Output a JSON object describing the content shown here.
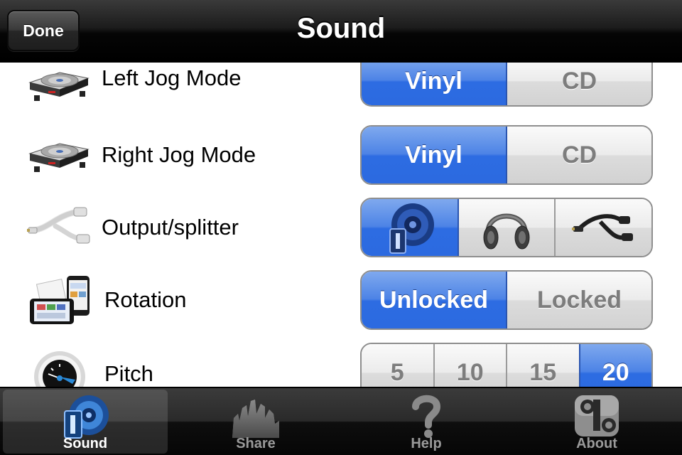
{
  "navbar": {
    "done_label": "Done",
    "title": "Sound"
  },
  "rows": [
    {
      "label": "Left Jog Mode",
      "icon": "turntable-icon",
      "options": [
        "Vinyl",
        "CD"
      ],
      "selected": "Vinyl"
    },
    {
      "label": "Right Jog Mode",
      "icon": "turntable-icon",
      "options": [
        "Vinyl",
        "CD"
      ],
      "selected": "Vinyl"
    },
    {
      "label": "Output/splitter",
      "icon": "audio-splitter-cable-icon",
      "options": [
        "speaker-icon",
        "headphones-icon",
        "splitter-cable-icon"
      ],
      "selected": "speaker-icon"
    },
    {
      "label": "Rotation",
      "icon": "ipod-devices-icon",
      "options": [
        "Unlocked",
        "Locked"
      ],
      "selected": "Unlocked"
    },
    {
      "label": "Pitch",
      "icon": "pitch-dial-icon",
      "options": [
        "5",
        "10",
        "15",
        "20"
      ],
      "selected": "20"
    }
  ],
  "tabbar": {
    "tabs": [
      {
        "label": "Sound",
        "icon": "speaker-app-icon",
        "active": true
      },
      {
        "label": "Share",
        "icon": "crowd-icon",
        "active": false
      },
      {
        "label": "Help",
        "icon": "question-mark-icon",
        "active": false
      },
      {
        "label": "About",
        "icon": "app-logo-icon",
        "active": false
      }
    ]
  },
  "colors": {
    "selected_segment": "#3a74e4",
    "unselected_text": "#7d7d7d",
    "bar_dark": "#1c1c1c"
  }
}
